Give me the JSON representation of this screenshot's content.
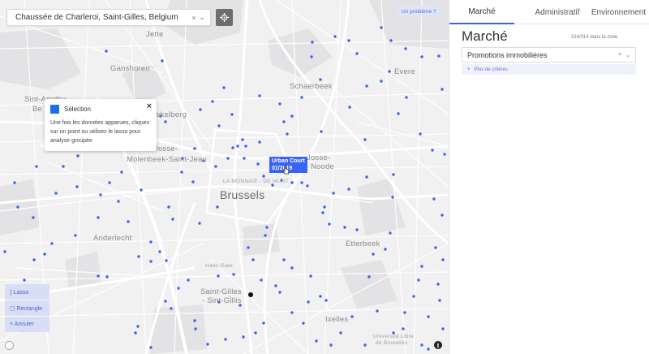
{
  "search": {
    "value": "Chaussée de Charleroi, Saint-Gilles, Belgium",
    "clear_glyph": "×",
    "dropdown_glyph": "⌄"
  },
  "map": {
    "problem_button": "Un problème ?",
    "places": {
      "jette": "Jette",
      "ganshoren": "Ganshoren",
      "schaerbeek": "Schaerbeek",
      "evere": "Evere",
      "berchem_a": "Sint-Agatha-",
      "berchem_b": "Be",
      "koekelberg": "Koekelberg",
      "molenbeek_a": "Sint-Jans-",
      "molenbeek_b": "Molenbeek",
      "jean_a": "Saint-",
      "jean_b": "Molenbeek-Saint-Jean",
      "josse_a": "Josse-",
      "josse_b": "Noode",
      "monnaie": "LA MONNAIE - DE MUNT",
      "brussels": "Brussels",
      "anderlecht": "Anderlecht",
      "etterbeek": "Etterbeek",
      "saint_gilles_a": "Saint-Gilles",
      "saint_gilles_b": "- Sint-Gillis",
      "ixelles": "Ixelles",
      "ulb": "Université Libre",
      "bruxelles_south": "de Bruxelles",
      "midi": "Halle-Gate"
    },
    "selection_popup": {
      "title": "Sélection",
      "close_glyph": "×",
      "body": "Une fois les données apparues, cliquez sur un point ou utilisez le lasso pour analyse groupée"
    },
    "tooltip": {
      "line1": "Urban Court",
      "line2": "01/2019"
    },
    "tools": {
      "lasso": "⟆ Lasso",
      "rectangle": "▢ Rectangle",
      "cancel": "× Annuler"
    },
    "info_glyph": "i",
    "marker_color": "#3c63f0",
    "point_total": "314/314"
  },
  "panel": {
    "tabs": [
      "Marché",
      "Administratif",
      "Environnement"
    ],
    "active_tab": "Marché",
    "title": "Marché",
    "count": "314/314 dans la zone",
    "filter": {
      "value": "Promotions immobilières",
      "clear_glyph": "×",
      "dropdown_glyph": "⌄"
    },
    "more_criteria": "Plus de critères",
    "more_criteria_glyph": "+"
  },
  "colors": {
    "accent": "#3c63f0",
    "map_bg": "#f1f1f2",
    "park": "#e4e4e6"
  }
}
